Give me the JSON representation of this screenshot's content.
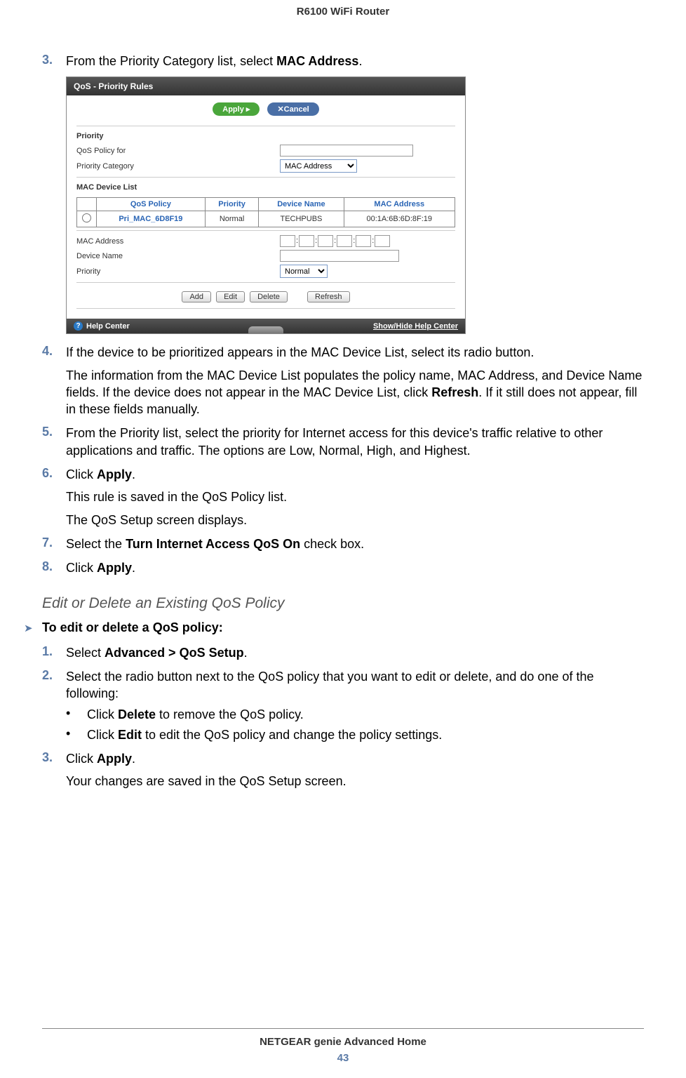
{
  "header": {
    "title": "R6100 WiFi Router"
  },
  "steps": {
    "s3": {
      "num": "3.",
      "pre": "From the Priority Category list, select ",
      "bold": "MAC Address",
      "post": "."
    },
    "s4": {
      "num": "4.",
      "line": "If the device to be prioritized appears in the MAC Device List, select its radio button.",
      "p1a": "The information from the MAC Device List populates the policy name, MAC Address, and Device Name fields. If the device does not appear in the MAC Device List, click ",
      "p1b": "Refresh",
      "p1c": ". If it still does not appear, fill in these fields manually."
    },
    "s5": {
      "num": "5.",
      "line": "From the Priority list, select the priority for Internet access for this device's traffic relative to other applications and traffic. The options are Low, Normal, High, and Highest."
    },
    "s6": {
      "num": "6.",
      "pre": "Click ",
      "bold": "Apply",
      "post": ".",
      "p1": "This rule is saved in the QoS Policy list.",
      "p2": "The QoS Setup screen displays."
    },
    "s7": {
      "num": "7.",
      "pre": "Select the ",
      "bold": "Turn Internet Access QoS On",
      "post": " check box."
    },
    "s8": {
      "num": "8.",
      "pre": "Click ",
      "bold": "Apply",
      "post": "."
    }
  },
  "section2": {
    "heading": "Edit or Delete an Existing QoS Policy",
    "proc": "To edit or delete a QoS policy:",
    "s1": {
      "num": "1.",
      "pre": "Select ",
      "bold": "Advanced > QoS Setup",
      "post": "."
    },
    "s2": {
      "num": "2.",
      "line": "Select the radio button next to the QoS policy that you want to edit or delete, and do one of the following:"
    },
    "b1": {
      "pre": "Click ",
      "bold": "Delete",
      "post": " to remove the QoS policy."
    },
    "b2": {
      "pre": "Click ",
      "bold": "Edit",
      "post": " to edit the QoS policy and change the policy settings."
    },
    "s3": {
      "num": "3.",
      "pre": "Click ",
      "bold": "Apply",
      "post": ".",
      "p1": "Your changes are saved in the QoS Setup screen."
    }
  },
  "screenshot": {
    "title": "QoS - Priority Rules",
    "apply": "Apply ▸",
    "cancel": "✕Cancel",
    "priority_section": "Priority",
    "qos_policy_for": "QoS Policy for",
    "priority_category": "Priority Category",
    "priority_category_value": "MAC Address",
    "mac_list_section": "MAC Device List",
    "table": {
      "h1": "QoS Policy",
      "h2": "Priority",
      "h3": "Device Name",
      "h4": "MAC Address",
      "r1": {
        "policy": "Pri_MAC_6D8F19",
        "priority": "Normal",
        "device": "TECHPUBS",
        "mac": "00:1A:6B:6D:8F:19"
      }
    },
    "mac_address": "MAC Address",
    "device_name": "Device Name",
    "priority_label": "Priority",
    "priority_value": "Normal",
    "btns": {
      "add": "Add",
      "edit": "Edit",
      "delete": "Delete",
      "refresh": "Refresh"
    },
    "help_center": "Help Center",
    "show_hide": "Show/Hide Help Center"
  },
  "footer": {
    "text": "NETGEAR genie Advanced Home",
    "page": "43"
  }
}
